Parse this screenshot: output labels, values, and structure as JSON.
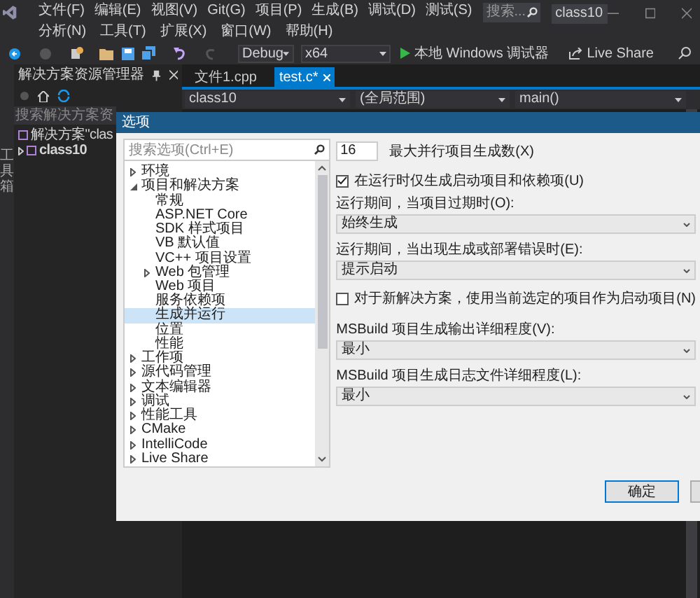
{
  "menu_row_1": [
    "文件(F)",
    "编辑(E)",
    "视图(V)",
    "Git(G)",
    "项目(P)",
    "生成(B)",
    "调试(D)",
    "测试(S)"
  ],
  "menu_row_2": [
    "分析(N)",
    "工具(T)",
    "扩展(X)",
    "窗口(W)",
    "帮助(H)"
  ],
  "search": {
    "placeholder": "搜索..."
  },
  "window_title": "class10",
  "toolbar": {
    "configuration": "Debug",
    "platform": "x64",
    "run_label": "本地 Windows 调试器",
    "live_share": "Live Share"
  },
  "side_strip": "工具箱",
  "solution_explorer": {
    "title": "解决方案资源管理器",
    "search_placeholder": "搜索解决方案资",
    "items": [
      {
        "label": "解决方案\"clas",
        "bold": false
      },
      {
        "label": "class10",
        "bold": true,
        "expanded": false
      }
    ]
  },
  "tabs": [
    {
      "label": "文件1.cpp",
      "selected": false
    },
    {
      "label": "test.c*",
      "selected": true
    }
  ],
  "nav_bar": [
    "class10",
    "(全局范围)",
    "main()"
  ],
  "dialog": {
    "title": "选项",
    "search_placeholder": "搜索选项(Ctrl+E)",
    "tree": [
      {
        "label": "环境",
        "expanded": false,
        "selected": false
      },
      {
        "label": "项目和解决方案",
        "expanded": true,
        "selected": false,
        "children": [
          {
            "label": "常规",
            "selected": false
          },
          {
            "label": "ASP.NET Core",
            "selected": false
          },
          {
            "label": "SDK 样式项目",
            "selected": false
          },
          {
            "label": "VB 默认值",
            "selected": false
          },
          {
            "label": "VC++ 项目设置",
            "selected": false
          },
          {
            "label": "Web 包管理",
            "expanded": false,
            "selected": false
          },
          {
            "label": "Web 项目",
            "selected": false
          },
          {
            "label": "服务依赖项",
            "selected": false
          },
          {
            "label": "生成并运行",
            "selected": true
          },
          {
            "label": "位置",
            "selected": false
          },
          {
            "label": "性能",
            "selected": false
          }
        ]
      },
      {
        "label": "工作项",
        "expanded": false,
        "selected": false
      },
      {
        "label": "源代码管理",
        "expanded": false,
        "selected": false
      },
      {
        "label": "文本编辑器",
        "expanded": false,
        "selected": false
      },
      {
        "label": "调试",
        "expanded": false,
        "selected": false
      },
      {
        "label": "性能工具",
        "expanded": false,
        "selected": false
      },
      {
        "label": "CMake",
        "expanded": false,
        "selected": false
      },
      {
        "label": "IntelliCode",
        "expanded": false,
        "selected": false
      },
      {
        "label": "Live Share",
        "expanded": false,
        "selected": false
      }
    ],
    "settings": [
      {
        "kind": "number",
        "value": "16",
        "label": "最大并行项目生成数(X)"
      },
      {
        "kind": "checkbox",
        "checked": true,
        "label": "在运行时仅生成启动项目和依赖项(U)"
      },
      {
        "kind": "select",
        "label": "运行期间，当项目过期时(O):",
        "value": "始终生成"
      },
      {
        "kind": "select",
        "label": "运行期间，当出现生成或部署错误时(E):",
        "value": "提示启动"
      },
      {
        "kind": "checkbox",
        "checked": false,
        "label": "对于新解决方案，使用当前选定的项目作为启动项目(N)"
      },
      {
        "kind": "select",
        "label": "MSBuild 项目生成输出详细程度(V):",
        "value": "最小"
      },
      {
        "kind": "select",
        "label": "MSBuild 项目生成日志文件详细程度(L):",
        "value": "最小"
      }
    ],
    "ok_button": "确定"
  }
}
